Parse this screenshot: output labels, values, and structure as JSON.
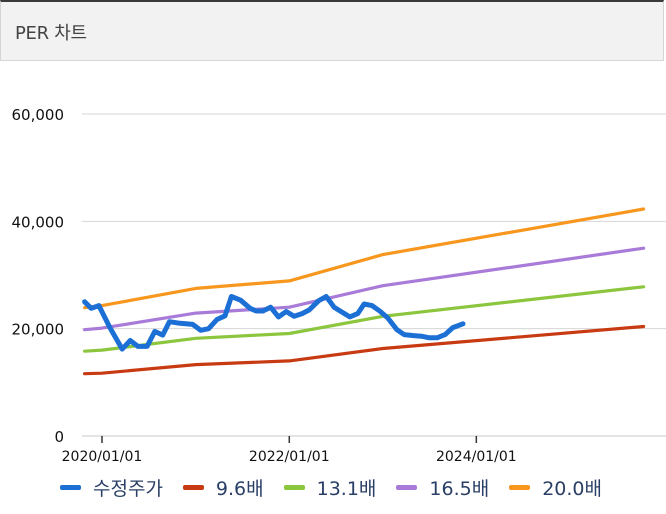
{
  "header": {
    "title": "PER 차트"
  },
  "chart_data": {
    "type": "line",
    "yticks": [
      "0",
      "20,000",
      "40,000",
      "60,000"
    ],
    "ytick_values": [
      0,
      20000,
      40000,
      60000
    ],
    "ylim": [
      0,
      60000
    ],
    "xticks": [
      "2020/01/01",
      "2022/01/01",
      "2024/01/01"
    ],
    "xtick_dates": [
      "2020-01-01",
      "2022-01-01",
      "2024-01-01"
    ],
    "xlim": [
      "2019-10-15",
      "2025-11-01"
    ],
    "grid": "horizontal",
    "legend_position": "bottom",
    "series": [
      {
        "name": "수정주가",
        "color": "#1c6fd4",
        "points": [
          [
            "2019-10-25",
            25000
          ],
          [
            "2019-11-20",
            23800
          ],
          [
            "2019-12-20",
            24300
          ],
          [
            "2020-02-01",
            20200
          ],
          [
            "2020-03-20",
            16200
          ],
          [
            "2020-04-20",
            17800
          ],
          [
            "2020-05-20",
            16700
          ],
          [
            "2020-06-25",
            16700
          ],
          [
            "2020-07-25",
            19500
          ],
          [
            "2020-08-25",
            18800
          ],
          [
            "2020-09-20",
            21300
          ],
          [
            "2020-11-01",
            21000
          ],
          [
            "2020-12-20",
            20800
          ],
          [
            "2021-01-20",
            19700
          ],
          [
            "2021-02-20",
            20000
          ],
          [
            "2021-03-25",
            21700
          ],
          [
            "2021-04-25",
            22400
          ],
          [
            "2021-05-20",
            26000
          ],
          [
            "2021-06-25",
            25300
          ],
          [
            "2021-08-01",
            23800
          ],
          [
            "2021-08-25",
            23300
          ],
          [
            "2021-09-20",
            23300
          ],
          [
            "2021-10-20",
            24000
          ],
          [
            "2021-11-20",
            22200
          ],
          [
            "2021-12-20",
            23200
          ],
          [
            "2022-01-20",
            22300
          ],
          [
            "2022-02-20",
            22800
          ],
          [
            "2022-03-20",
            23500
          ],
          [
            "2022-04-25",
            25200
          ],
          [
            "2022-05-25",
            26000
          ],
          [
            "2022-06-25",
            24000
          ],
          [
            "2022-08-01",
            22900
          ],
          [
            "2022-08-25",
            22200
          ],
          [
            "2022-09-25",
            22800
          ],
          [
            "2022-10-20",
            24600
          ],
          [
            "2022-11-20",
            24300
          ],
          [
            "2022-12-20",
            23300
          ],
          [
            "2023-01-20",
            22000
          ],
          [
            "2023-02-25",
            19800
          ],
          [
            "2023-03-25",
            18900
          ],
          [
            "2023-05-01",
            18700
          ],
          [
            "2023-06-01",
            18600
          ],
          [
            "2023-07-01",
            18300
          ],
          [
            "2023-08-01",
            18300
          ],
          [
            "2023-09-01",
            18900
          ],
          [
            "2023-10-01",
            20200
          ],
          [
            "2023-11-10",
            20900
          ]
        ]
      },
      {
        "name": "9.6배",
        "color": "#c83a12",
        "points": [
          [
            "2019-10-25",
            11600
          ],
          [
            "2020-01-01",
            11700
          ],
          [
            "2021-01-01",
            13300
          ],
          [
            "2022-01-01",
            14000
          ],
          [
            "2023-01-01",
            16300
          ],
          [
            "2025-10-15",
            20400
          ]
        ]
      },
      {
        "name": "13.1배",
        "color": "#8cc63e",
        "points": [
          [
            "2019-10-25",
            15800
          ],
          [
            "2020-01-01",
            16000
          ],
          [
            "2021-01-01",
            18200
          ],
          [
            "2022-01-01",
            19100
          ],
          [
            "2023-01-01",
            22300
          ],
          [
            "2025-10-15",
            27800
          ]
        ]
      },
      {
        "name": "16.5배",
        "color": "#a97bd8",
        "points": [
          [
            "2019-10-25",
            19800
          ],
          [
            "2020-01-01",
            20100
          ],
          [
            "2021-01-01",
            22900
          ],
          [
            "2022-01-01",
            24000
          ],
          [
            "2023-01-01",
            28000
          ],
          [
            "2025-10-15",
            35000
          ]
        ]
      },
      {
        "name": "20.0배",
        "color": "#f7971e",
        "points": [
          [
            "2019-10-25",
            23900
          ],
          [
            "2020-01-01",
            24300
          ],
          [
            "2021-01-01",
            27500
          ],
          [
            "2022-01-01",
            28900
          ],
          [
            "2023-01-01",
            33800
          ],
          [
            "2025-10-15",
            42300
          ]
        ]
      }
    ]
  }
}
